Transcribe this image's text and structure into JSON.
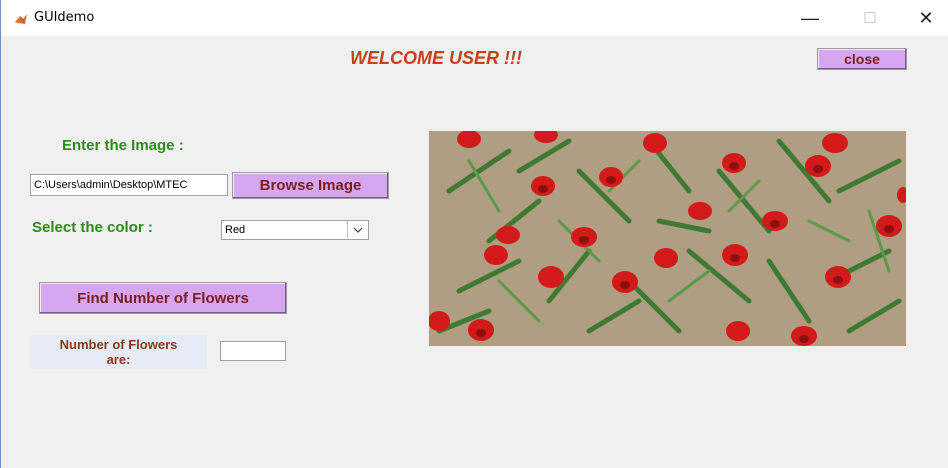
{
  "window": {
    "title": "GUIdemo",
    "minimize_glyph": "—",
    "maximize_glyph": "☐",
    "close_glyph": "✕"
  },
  "heading": "WELCOME USER !!!",
  "close_button": "close",
  "image_section": {
    "label": "Enter the Image :",
    "path_value": "C:\\Users\\admin\\Desktop\\MTEC",
    "browse_button": "Browse Image"
  },
  "color_section": {
    "label": "Select the color :",
    "selected": "Red"
  },
  "find_button": "Find Number of Flowers",
  "count_section": {
    "label_line1": "Number of Flowers",
    "label_line2": "are:",
    "value": ""
  },
  "colors": {
    "accent_button": "#d6a6f0",
    "heading": "#c8401a",
    "label_green": "#2e8b1a",
    "flower_red": "#d21a1a",
    "leaf_green": "#3f7a34",
    "soil": "#b7a58a"
  },
  "icons": {
    "app": "matlab-icon",
    "dropdown": "chevron-down-icon"
  }
}
